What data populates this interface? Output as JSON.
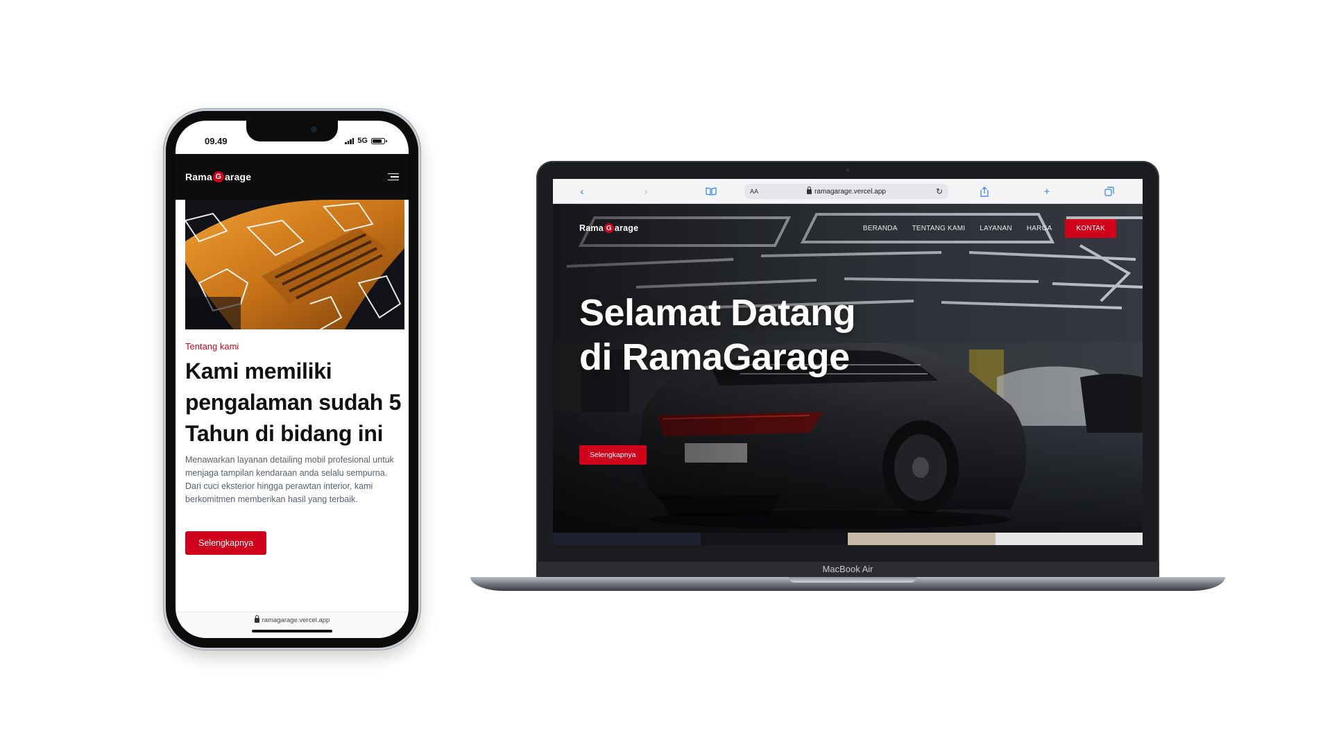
{
  "phone": {
    "status": {
      "time": "09.49",
      "network": "5G"
    },
    "nav": {
      "logo_pre": "Rama",
      "logo_g": "G",
      "logo_post": "arage",
      "menu_icon": "hamburger-icon"
    },
    "about": {
      "eyebrow": "Tentang kami",
      "heading": "Kami memiliki pengalaman sudah 5 Tahun di bidang ini",
      "description": "Menawarkan layanan detailing mobil profesional untuk menjaga tampilan kendaraan anda selalu sempurna. Dari cuci eksterior hingga perawtan interior, kami berkomitmen memberikan hasil yang terbaik.",
      "button": "Selengkapnya"
    },
    "url": "ramagarage.vercel.app"
  },
  "laptop": {
    "browser": {
      "aa": "AA",
      "url": "ramagarage.vercel.app"
    },
    "nav": {
      "logo_pre": "Rama",
      "logo_g": "G",
      "logo_post": "arage",
      "items": [
        "BERANDA",
        "TENTANG KAMI",
        "LAYANAN",
        "HARGA"
      ],
      "cta": "KONTAK"
    },
    "hero": {
      "title": "Selamat Datang di RamaGarage",
      "button": "Selengkapnya"
    },
    "model_label": "MacBook Air"
  },
  "colors": {
    "accent": "#d0021b",
    "nav_bg": "#0d0d0d"
  }
}
